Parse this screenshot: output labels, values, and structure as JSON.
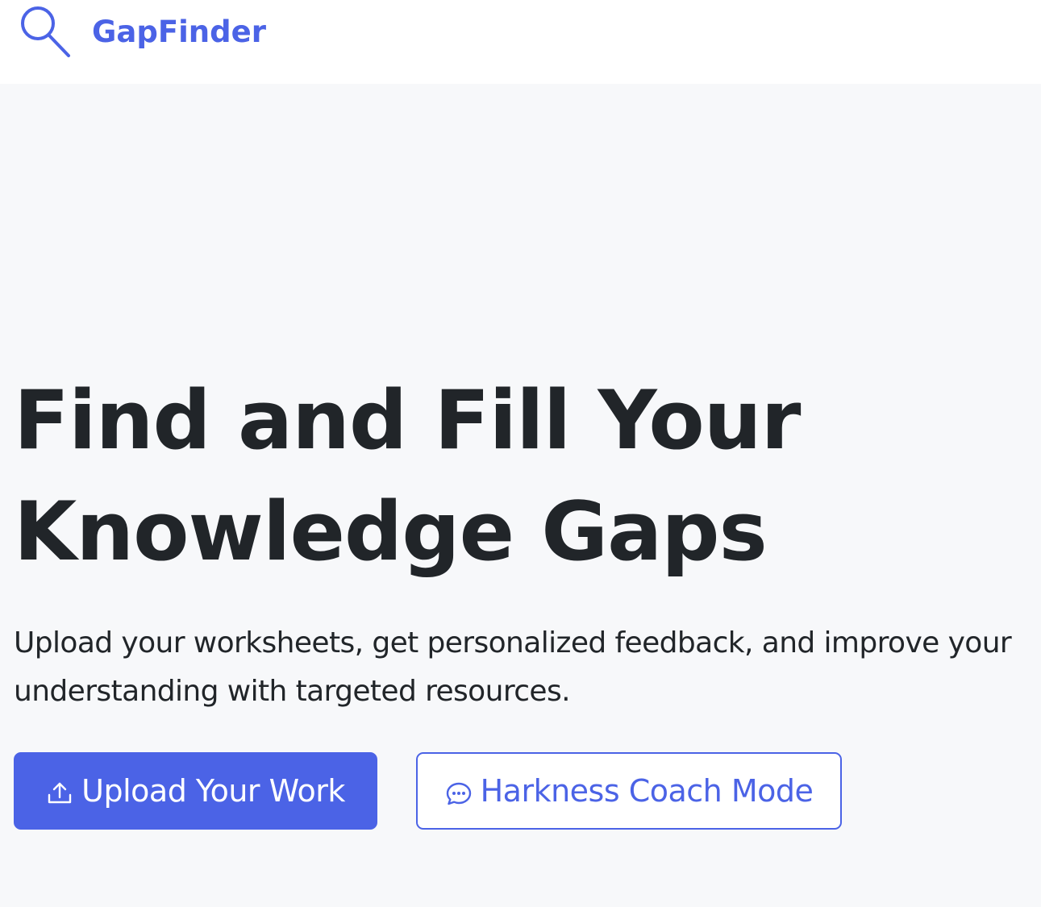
{
  "navbar": {
    "brand_name": "GapFinder",
    "brand_icon": "search-icon"
  },
  "hero": {
    "title_line1": "Find and Fill Your",
    "title_line2": "Knowledge Gaps",
    "subtitle": "Upload your worksheets, get personalized feedback, and improve your understanding with targeted resources."
  },
  "actions": {
    "upload_label": "Upload Your Work",
    "upload_icon": "upload-icon",
    "coach_label": "Harkness Coach Mode",
    "coach_icon": "chat-bubble-icon"
  },
  "colors": {
    "accent": "#4b63e6",
    "text": "#212529",
    "background": "#f7f8fa",
    "navbar_background": "#ffffff"
  }
}
